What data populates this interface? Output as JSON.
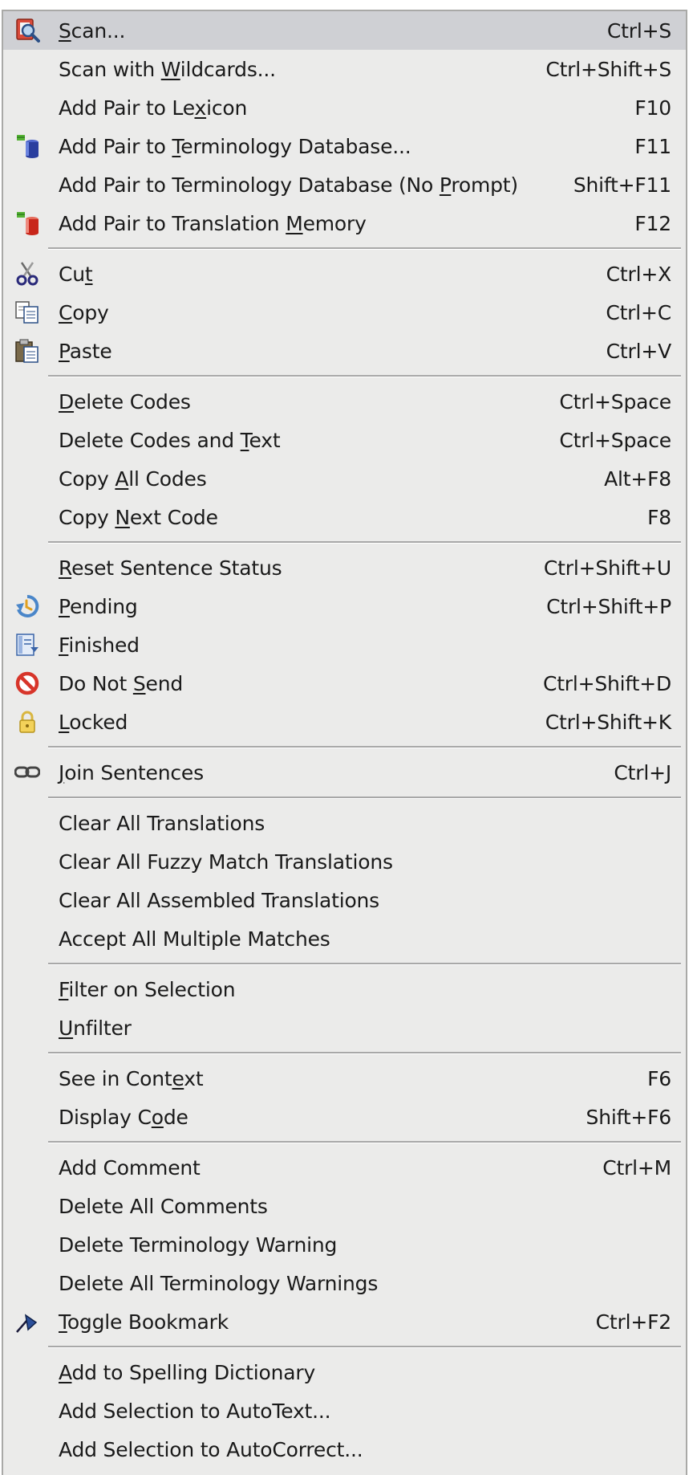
{
  "menu": {
    "groups": [
      [
        {
          "label": "Scan...",
          "mnemonic": 0,
          "shortcut": "Ctrl+S",
          "icon": "scan-icon",
          "selected": true
        },
        {
          "label": "Scan with Wildcards...",
          "mnemonic": 10,
          "shortcut": "Ctrl+Shift+S"
        },
        {
          "label": "Add Pair to Lexicon",
          "mnemonic": 14,
          "shortcut": "F10"
        },
        {
          "label": "Add Pair to Terminology Database...",
          "mnemonic": 12,
          "shortcut": "F11",
          "icon": "terminology-database-icon"
        },
        {
          "label": "Add Pair to Terminology Database (No Prompt)",
          "mnemonic": 37,
          "shortcut": "Shift+F11"
        },
        {
          "label": "Add Pair to Translation Memory",
          "mnemonic": 24,
          "shortcut": "F12",
          "icon": "translation-memory-icon"
        }
      ],
      [
        {
          "label": "Cut",
          "mnemonic": 2,
          "shortcut": "Ctrl+X",
          "icon": "scissors-icon"
        },
        {
          "label": "Copy",
          "mnemonic": 0,
          "shortcut": "Ctrl+C",
          "icon": "copy-icon"
        },
        {
          "label": "Paste",
          "mnemonic": 0,
          "shortcut": "Ctrl+V",
          "icon": "paste-icon"
        }
      ],
      [
        {
          "label": "Delete Codes",
          "mnemonic": 0,
          "shortcut": "Ctrl+Space"
        },
        {
          "label": "Delete Codes and Text",
          "mnemonic": 17,
          "shortcut": "Ctrl+Space"
        },
        {
          "label": "Copy All Codes",
          "mnemonic": 5,
          "shortcut": "Alt+F8"
        },
        {
          "label": "Copy Next Code",
          "mnemonic": 5,
          "shortcut": "F8"
        }
      ],
      [
        {
          "label": "Reset Sentence Status",
          "mnemonic": 0,
          "shortcut": "Ctrl+Shift+U"
        },
        {
          "label": "Pending",
          "mnemonic": 0,
          "shortcut": "Ctrl+Shift+P",
          "icon": "pending-icon"
        },
        {
          "label": "Finished",
          "mnemonic": 0,
          "shortcut": "",
          "icon": "finished-icon"
        },
        {
          "label": "Do Not Send",
          "mnemonic": 7,
          "shortcut": "Ctrl+Shift+D",
          "icon": "do-not-send-icon"
        },
        {
          "label": "Locked",
          "mnemonic": 0,
          "shortcut": "Ctrl+Shift+K",
          "icon": "lock-icon"
        }
      ],
      [
        {
          "label": "Join Sentences",
          "mnemonic": 0,
          "shortcut": "Ctrl+J",
          "icon": "join-sentences-icon"
        }
      ],
      [
        {
          "label": "Clear All Translations",
          "shortcut": ""
        },
        {
          "label": "Clear All Fuzzy Match Translations",
          "shortcut": ""
        },
        {
          "label": "Clear All Assembled Translations",
          "shortcut": ""
        },
        {
          "label": "Accept All Multiple Matches",
          "shortcut": ""
        }
      ],
      [
        {
          "label": "Filter on Selection",
          "mnemonic": 0,
          "shortcut": ""
        },
        {
          "label": "Unfilter",
          "mnemonic": 0,
          "shortcut": ""
        }
      ],
      [
        {
          "label": "See in Context",
          "mnemonic": 11,
          "shortcut": "F6"
        },
        {
          "label": "Display Code",
          "mnemonic": 9,
          "shortcut": "Shift+F6"
        }
      ],
      [
        {
          "label": "Add Comment",
          "shortcut": "Ctrl+M"
        },
        {
          "label": "Delete All Comments",
          "shortcut": ""
        },
        {
          "label": "Delete Terminology Warning",
          "shortcut": ""
        },
        {
          "label": "Delete All Terminology Warnings",
          "shortcut": ""
        },
        {
          "label": "Toggle Bookmark",
          "mnemonic": 0,
          "shortcut": "Ctrl+F2",
          "icon": "bookmark-icon"
        }
      ],
      [
        {
          "label": "Add to Spelling Dictionary",
          "mnemonic": 0,
          "shortcut": ""
        },
        {
          "label": "Add Selection to AutoText...",
          "shortcut": ""
        },
        {
          "label": "Add Selection to AutoCorrect...",
          "shortcut": ""
        }
      ]
    ]
  },
  "colors": {
    "menu_background": "#ebebea",
    "selected_background": "#cfd0d4",
    "separator": "#a8a8a8",
    "text": "#1a1a1a"
  }
}
